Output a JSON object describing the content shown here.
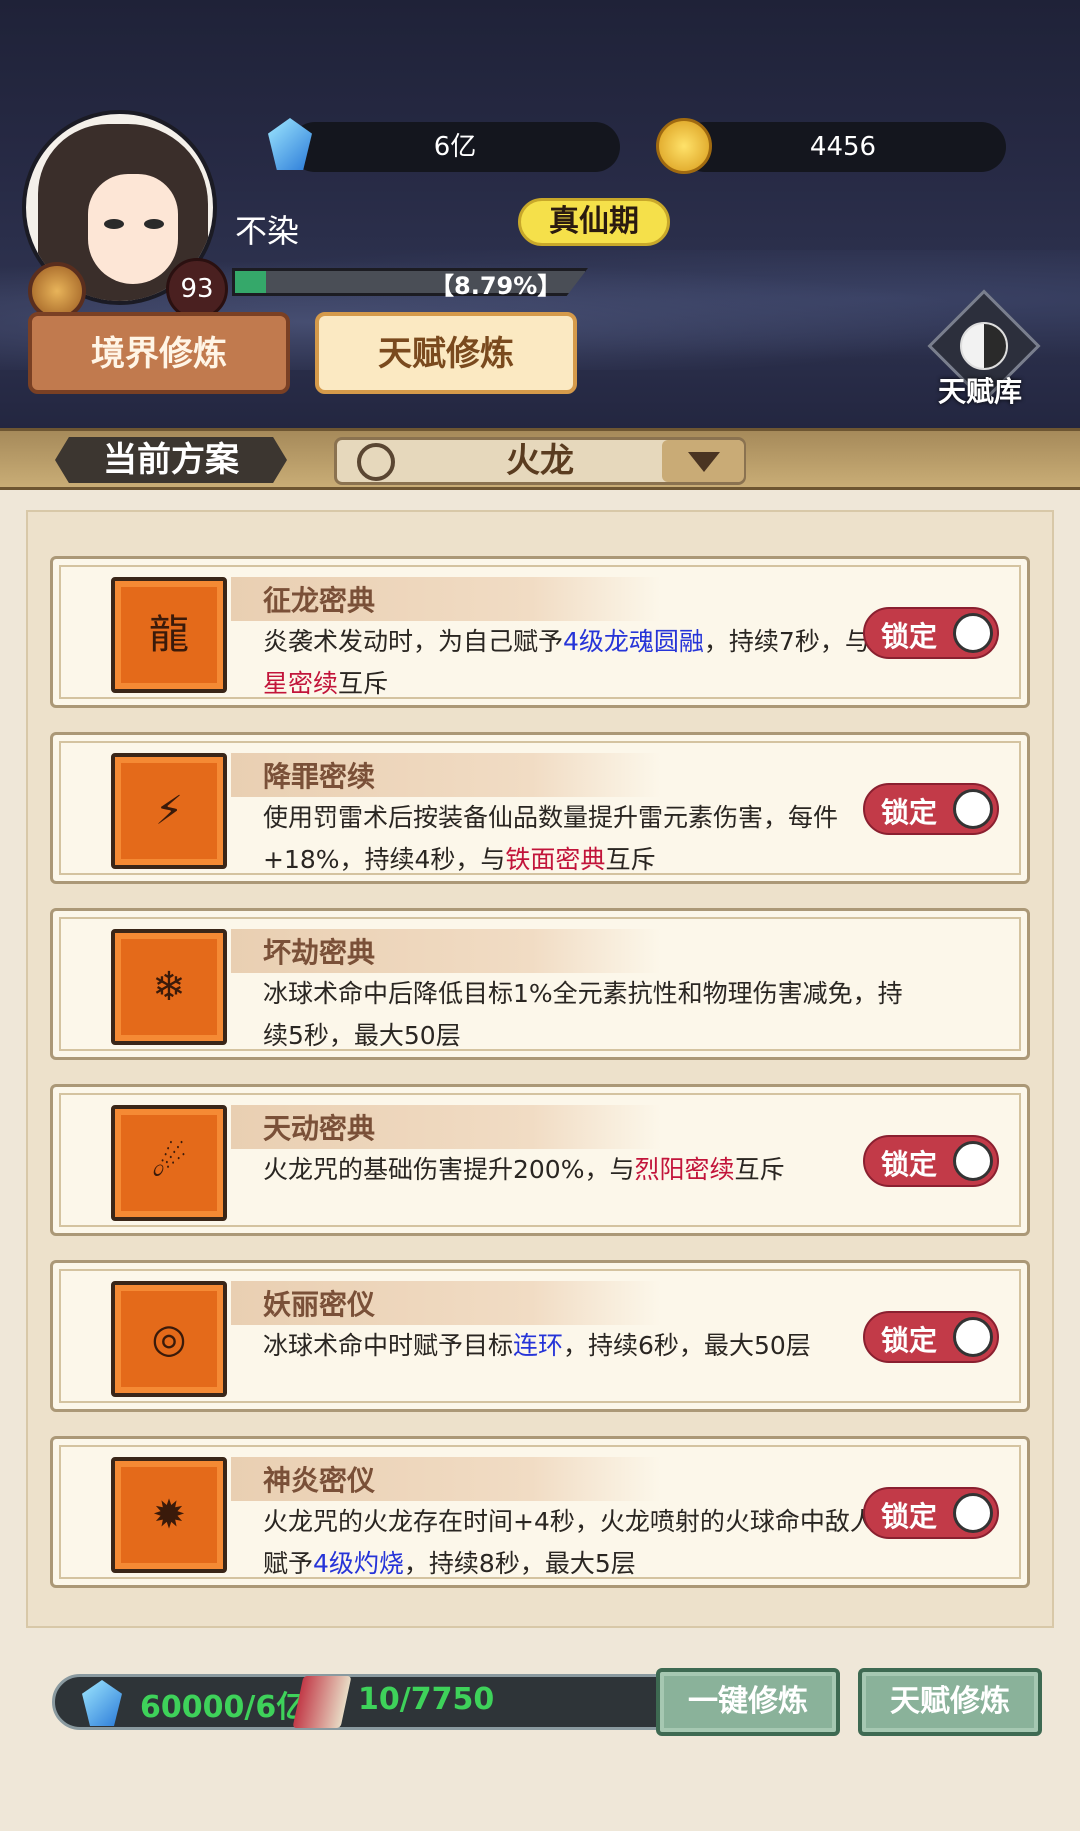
{
  "player": {
    "name": "不染",
    "level": "93",
    "realm": "真仙期",
    "exp_text": "【8.79%】",
    "exp_fraction": 0.0879
  },
  "resources": {
    "gem": "6亿",
    "coin": "4456"
  },
  "tabs": {
    "realm": "境界修炼",
    "talent": "天赋修炼"
  },
  "talent_library": "天赋库",
  "scheme": {
    "label": "当前方案",
    "value": "火龙"
  },
  "cards": [
    {
      "title": "征龙密典",
      "icon": "dragon-emblem-icon",
      "desc_parts": [
        {
          "t": "炎袭术发动时，为自己赋予",
          "c": ""
        },
        {
          "t": "4级龙魂圆融",
          "c": "blue"
        },
        {
          "t": "，持续7秒，与",
          "c": ""
        },
        {
          "t": "虎星密续",
          "c": "red"
        },
        {
          "t": "互斥",
          "c": ""
        }
      ],
      "lock": "锁定"
    },
    {
      "title": "降罪密续",
      "icon": "lightning-glyph-icon",
      "desc_parts": [
        {
          "t": "使用罚雷术后按装备仙品数量提升雷元素伤害，每件+18%，持续4秒，与",
          "c": ""
        },
        {
          "t": "铁面密典",
          "c": "red"
        },
        {
          "t": "互斥",
          "c": ""
        }
      ],
      "lock": "锁定"
    },
    {
      "title": "坏劫密典",
      "icon": "ice-orb-icon",
      "desc_parts": [
        {
          "t": "冰球术命中后降低目标1%全元素抗性和物理伤害减免，持续5秒，最大50层",
          "c": ""
        }
      ],
      "lock": ""
    },
    {
      "title": "天动密典",
      "icon": "fireball-icon",
      "desc_parts": [
        {
          "t": "火龙咒的基础伤害提升200%，与",
          "c": ""
        },
        {
          "t": "烈阳密续",
          "c": "red"
        },
        {
          "t": "互斥",
          "c": ""
        }
      ],
      "lock": "锁定"
    },
    {
      "title": "妖丽密仪",
      "icon": "chain-ring-icon",
      "desc_parts": [
        {
          "t": "冰球术命中时赋予目标",
          "c": ""
        },
        {
          "t": "连环",
          "c": "blue"
        },
        {
          "t": "，持续6秒，最大50层",
          "c": ""
        }
      ],
      "lock": "锁定"
    },
    {
      "title": "神炎密仪",
      "icon": "flame-demon-icon",
      "desc_parts": [
        {
          "t": "火龙咒的火龙存在时间+4秒，火龙喷射的火球命中敌人会赋予",
          "c": ""
        },
        {
          "t": "4级灼烧",
          "c": "blue"
        },
        {
          "t": "，持续8秒，最大5层",
          "c": ""
        }
      ],
      "lock": "锁定"
    }
  ],
  "bottom": {
    "gem_cost": "60000/6亿",
    "scroll_cost": "10/7750",
    "one_click": "一键修炼",
    "talent_train": "天赋修炼"
  },
  "colors": {
    "blue_highlight": "#2634d8",
    "red_highlight": "#c2143a",
    "lock_bg": "#c23a48",
    "cost_green": "#3ed25a"
  }
}
